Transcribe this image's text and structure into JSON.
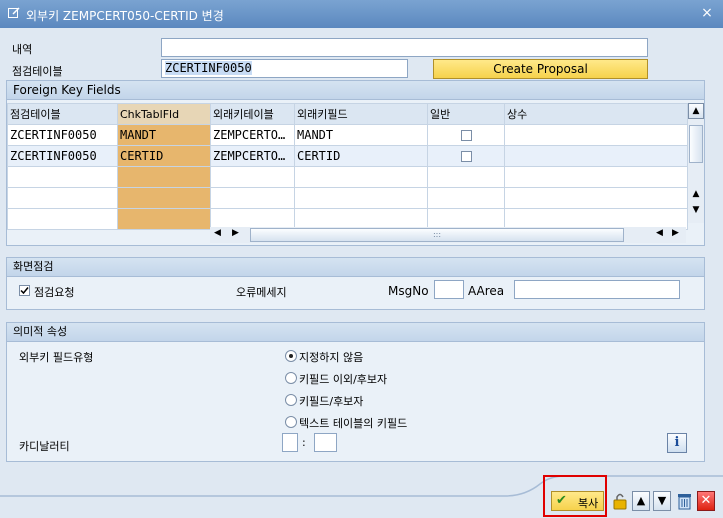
{
  "window": {
    "title": "외부키 ZEMPCERT050-CERTID 변경",
    "close_label": "×"
  },
  "form": {
    "desc_label": "내역",
    "desc_value": "",
    "check_table_label": "점검테이블",
    "check_table_value": "ZCERTINF0050",
    "create_proposal_label": "Create Proposal"
  },
  "fk_panel": {
    "title": "Foreign Key Fields",
    "columns": [
      "점검테이블",
      "ChkTablFld",
      "외래키테이블",
      "외래키필드",
      "일반",
      "상수"
    ],
    "rows": [
      {
        "check_table": "ZCERTINF0050",
        "chk_field": "MANDT",
        "fk_table": "ZEMPCERTO…",
        "fk_field": "MANDT",
        "general": false,
        "constant": ""
      },
      {
        "check_table": "ZCERTINF0050",
        "chk_field": "CERTID",
        "fk_table": "ZEMPCERTO…",
        "fk_field": "CERTID",
        "general": false,
        "constant": ""
      }
    ],
    "scroll_dots": ":::"
  },
  "screen_check": {
    "title": "화면점검",
    "check_required_label": "점검요청",
    "check_required": true,
    "error_msg_label": "오류메세지",
    "msgno_label": "MsgNo",
    "msgno_value": "",
    "aarea_label": "AArea",
    "aarea_value": ""
  },
  "semantic": {
    "title": "의미적 속성",
    "fk_type_label": "외부키 필드유형",
    "options": [
      "지정하지 않음",
      "키필드 이외/후보자",
      "키필드/후보자",
      "텍스트 테이블의 키필드"
    ],
    "selected_index": 0,
    "cardinality_label": "카디날러티",
    "card_left": "",
    "card_sep": ":",
    "card_right": ""
  },
  "footer": {
    "copy_label": "복사"
  },
  "colors": {
    "accent": "#5b88bf",
    "key_column": "#e7b66d",
    "highlight_box": "#e00000"
  }
}
